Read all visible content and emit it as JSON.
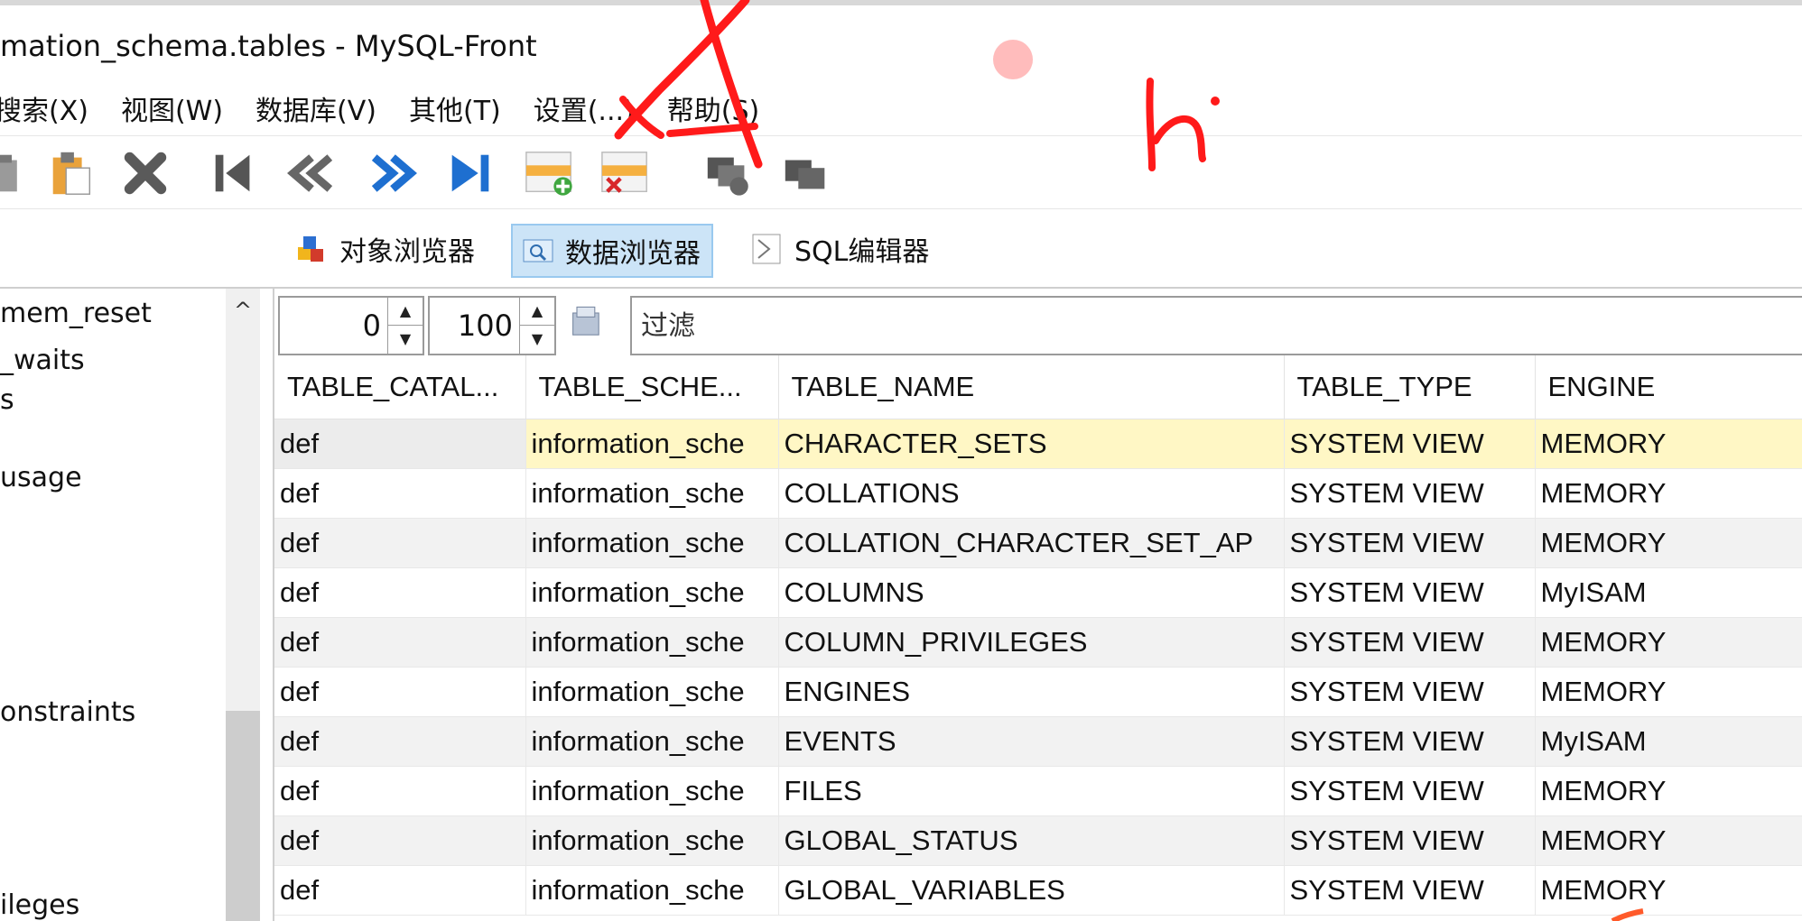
{
  "window": {
    "title": "mation_schema.tables - MySQL-Front"
  },
  "menu": [
    "搜索(X)",
    "视图(W)",
    "数据库(V)",
    "其他(T)",
    "设置(...)",
    "帮助(S)"
  ],
  "toolbar": {
    "icons": [
      "home-icon",
      "paste-icon",
      "delete-icon",
      "first-record-icon",
      "prev-page-icon",
      "next-page-icon",
      "last-record-icon",
      "insert-record-icon",
      "delete-record-icon",
      "post-icon",
      "cancel-icon"
    ]
  },
  "views": {
    "objects": "对象浏览器",
    "data": "数据浏览器",
    "sql": "SQL编辑器"
  },
  "sidebar": {
    "items": [
      "mem_reset",
      "_waits",
      "s",
      "usage",
      "onstraints",
      "ileges"
    ]
  },
  "pager": {
    "offset": "0",
    "limit": "100"
  },
  "filter": {
    "placeholder": "过滤"
  },
  "table": {
    "columns": [
      "TABLE_CATAL...",
      "TABLE_SCHE...",
      "TABLE_NAME",
      "TABLE_TYPE",
      "ENGINE"
    ],
    "rows": [
      [
        "def",
        "information_sche",
        "CHARACTER_SETS",
        "SYSTEM VIEW",
        "MEMORY"
      ],
      [
        "def",
        "information_sche",
        "COLLATIONS",
        "SYSTEM VIEW",
        "MEMORY"
      ],
      [
        "def",
        "information_sche",
        "COLLATION_CHARACTER_SET_AP",
        "SYSTEM VIEW",
        "MEMORY"
      ],
      [
        "def",
        "information_sche",
        "COLUMNS",
        "SYSTEM VIEW",
        "MyISAM"
      ],
      [
        "def",
        "information_sche",
        "COLUMN_PRIVILEGES",
        "SYSTEM VIEW",
        "MEMORY"
      ],
      [
        "def",
        "information_sche",
        "ENGINES",
        "SYSTEM VIEW",
        "MEMORY"
      ],
      [
        "def",
        "information_sche",
        "EVENTS",
        "SYSTEM VIEW",
        "MyISAM"
      ],
      [
        "def",
        "information_sche",
        "FILES",
        "SYSTEM VIEW",
        "MEMORY"
      ],
      [
        "def",
        "information_sche",
        "GLOBAL_STATUS",
        "SYSTEM VIEW",
        "MEMORY"
      ],
      [
        "def",
        "information_sche",
        "GLOBAL_VARIABLES",
        "SYSTEM VIEW",
        "MEMORY"
      ]
    ]
  },
  "colors": {
    "selected_row": "#fff7c5",
    "active_tab": "#cce4f7",
    "annotation": "#ff1a1a"
  }
}
